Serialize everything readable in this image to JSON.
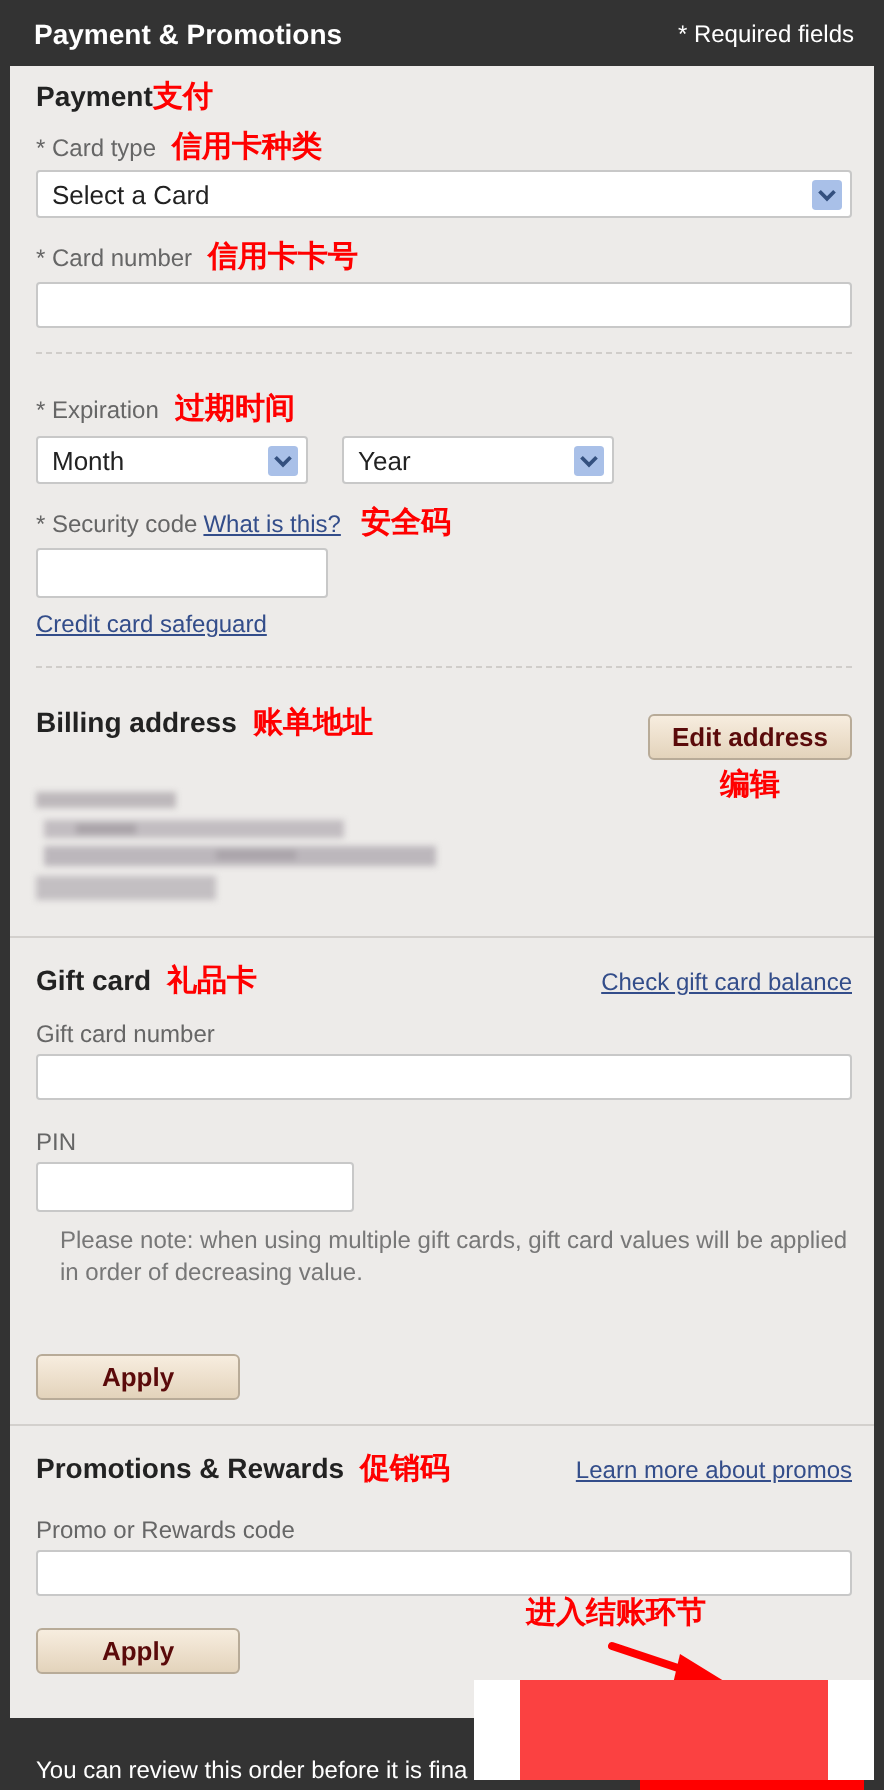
{
  "header": {
    "title": "Payment & Promotions",
    "note": "* Required fields"
  },
  "payment": {
    "heading": "Payment",
    "annotation": "支付",
    "card_type": {
      "label": "* Card type",
      "annotation": "信用卡种类",
      "value": "Select a Card"
    },
    "card_number": {
      "label": "* Card number",
      "annotation": "信用卡卡号"
    },
    "expiration": {
      "label": "* Expiration",
      "annotation": "过期时间",
      "month": "Month",
      "year": "Year"
    },
    "security_code": {
      "label": "* Security code",
      "link": "What is this?",
      "annotation": "安全码"
    },
    "safeguard_link": "Credit card safeguard"
  },
  "billing": {
    "heading": "Billing address",
    "annotation": "账单地址",
    "button": "Edit address",
    "button_annotation": "编辑"
  },
  "gift_card": {
    "heading": "Gift card",
    "annotation": "礼品卡",
    "link": "Check gift card balance",
    "number_label": "Gift card number",
    "pin_label": "PIN",
    "note": "Please note: when using multiple gift cards, gift card values will be applied in order of decreasing value.",
    "button": "Apply"
  },
  "promotions": {
    "heading": "Promotions & Rewards",
    "annotation": "促销码",
    "link": "Learn more about promos",
    "code_label": "Promo or Rewards code",
    "button": "Apply"
  },
  "footer": {
    "text": "You can review this order before it is fina",
    "annotation": "进入结账环节"
  }
}
